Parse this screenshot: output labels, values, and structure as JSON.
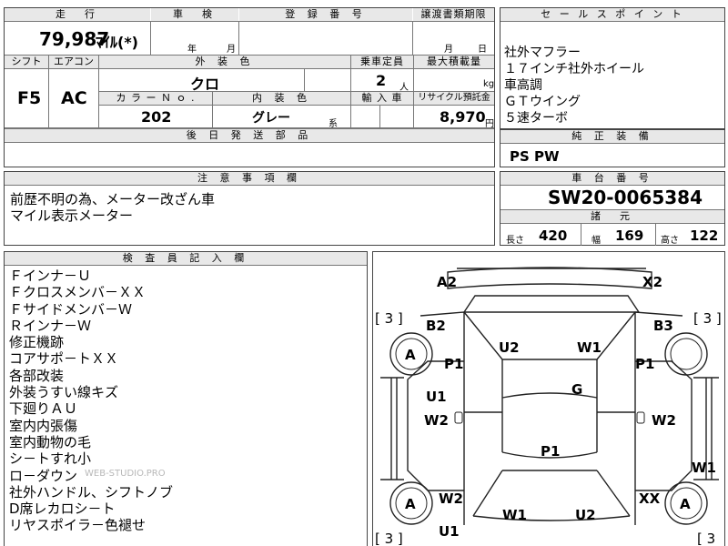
{
  "vehicle": {
    "mileage_header": "走　行",
    "mileage": "79,987",
    "mileage_unit": "ﾏｲﾙ(*)",
    "inspection_header": "車　検",
    "inspection_year": "年",
    "inspection_month": "月",
    "registration_header": "登 録 番 号",
    "transfer_header": "譲渡書類期限",
    "transfer_month": "月",
    "transfer_day": "日",
    "shift_header": "シフト",
    "shift": "F5",
    "ac_header": "エアコン",
    "ac": "AC",
    "exterior_color_header": "外 装 色",
    "exterior_color": "クロ",
    "capacity_header": "乗車定員",
    "capacity": "2",
    "capacity_unit": "人",
    "max_load_header": "最大積載量",
    "max_load_unit": "kg",
    "color_no_header": "カ ラ ー Ｎ ｏ .",
    "color_no": "202",
    "interior_color_header": "内 装 色",
    "interior_color": "グレー",
    "interior_color_suffix": "系",
    "import_header": "輸 入 車",
    "recycle_header": "リサイクル預託金",
    "recycle": "8,970",
    "recycle_unit": "円",
    "parts_header": "後 日 発 送 部 品"
  },
  "sales_points": {
    "header": "セ ー ル ス ポ イ ン ト",
    "items": [
      "社外マフラー",
      "１７インチ社外ホイール",
      "車高調",
      "ＧＴウイング",
      "５速ターボ"
    ]
  },
  "equipment": {
    "header": "純 正 装 備",
    "value": "PS PW"
  },
  "notes": {
    "header": "注 意 事 項 欄",
    "lines": [
      "前歴不明の為、メーター改ざん車",
      "マイル表示メーター"
    ]
  },
  "chassis": {
    "header": "車 台 番 号",
    "value": "SW20-0065384",
    "dims_header": "諸　元",
    "length_label": "長さ",
    "length": "420",
    "width_label": "幅",
    "width": "169",
    "height_label": "高さ",
    "height": "122"
  },
  "inspector": {
    "header": "検 査 員 記 入 欄",
    "lines": [
      "Ｆインナ－Ｕ",
      "Ｆクロスメンバ－ＸＸ",
      "Ｆサイドメンバ－Ｗ",
      "Ｒインナ－Ｗ",
      "修正機跡",
      "コアサポ－トＸＸ",
      "各部改装",
      "外装うすい線キズ",
      "下廻りＡＵ",
      "室内内張傷",
      "室内動物の毛",
      "シ－トすれ小",
      "ロ－ダウン",
      "社外ハンドル、シフトノブ",
      "D席レカロシ－ト",
      "リヤスポイラ－色褪せ"
    ],
    "watermark": "WEB-STUDIO.PRO"
  },
  "diagram": {
    "codes": {
      "a2": "A2",
      "x2": "X2",
      "b2": "B2",
      "b3": "B3",
      "u2": "U2",
      "w1_top": "W1",
      "a_fl": "A",
      "a_rl": "A",
      "a_rr": "A",
      "p1_l": "P1",
      "p1_r": "P1",
      "u1_l": "U1",
      "g": "G",
      "w2_l": "W2",
      "w2_r": "W2",
      "p1_roof": "P1",
      "w1_r": "W1",
      "w2_rl": "W2",
      "xx": "XX",
      "w1_bot": "W1",
      "u2_bot": "U2",
      "u1_bot": "U1",
      "b3_l": "[ 3 ]",
      "b3_r": "[ 3 ]",
      "b3_bl": "[ 3 ]",
      "b3_br": "[ 3"
    }
  }
}
